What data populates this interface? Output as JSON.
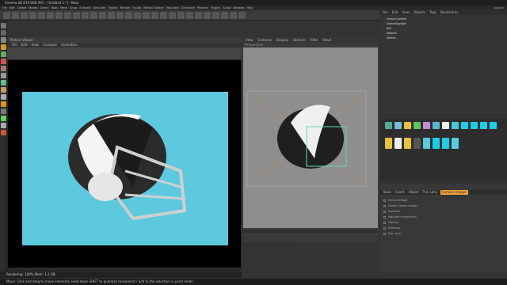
{
  "window": {
    "title": "Cinema 4D R19.068 (RC) - [Untitled 1 *] - Main"
  },
  "menubar": {
    "items": [
      "File",
      "Edit",
      "Create",
      "Modes",
      "Select",
      "Tools",
      "Mesh",
      "Snap",
      "Animate",
      "Simulate",
      "Tracker",
      "Render",
      "Sculpt",
      "Motion Tracker",
      "MoGraph",
      "Character",
      "Pipeline",
      "Plugins",
      "Script",
      "Window",
      "Help"
    ],
    "layout": "Layout:"
  },
  "picture_viewer": {
    "title": "Picture Viewer",
    "menu": [
      "File",
      "Edit",
      "View",
      "Compare",
      "Animation"
    ]
  },
  "viewport": {
    "menu": [
      "View",
      "Cameras",
      "Display",
      "Options",
      "Filter",
      "Panel"
    ],
    "label": "Perspective"
  },
  "object_manager": {
    "menu": [
      "File",
      "Edit",
      "View",
      "Objects",
      "Tags",
      "Bookmarks"
    ],
    "objects": [
      "Octane Camera",
      "OctaneDaylight",
      "Null",
      "Material",
      "Helmet"
    ]
  },
  "attributes": {
    "tabs": [
      "Basic",
      "Coord.",
      "Object",
      "Thin Lens",
      "Camera Imager"
    ],
    "rows": [
      "Camera Imager",
      "Enable Camera Imager",
      "Exposure",
      "Highlight compression",
      "Gamma",
      "Dithering",
      "Max. tone"
    ]
  },
  "status": {
    "render_line": "Rendering: 100% Mem: 1.2 GB",
    "bottom_line": "Move: Click and drag to move elements. Hold down SHIFT to quantize movement / add to the selection in point mode"
  },
  "colors": {
    "render_bg": "#5cc9de",
    "accent": "#f2a33a"
  }
}
